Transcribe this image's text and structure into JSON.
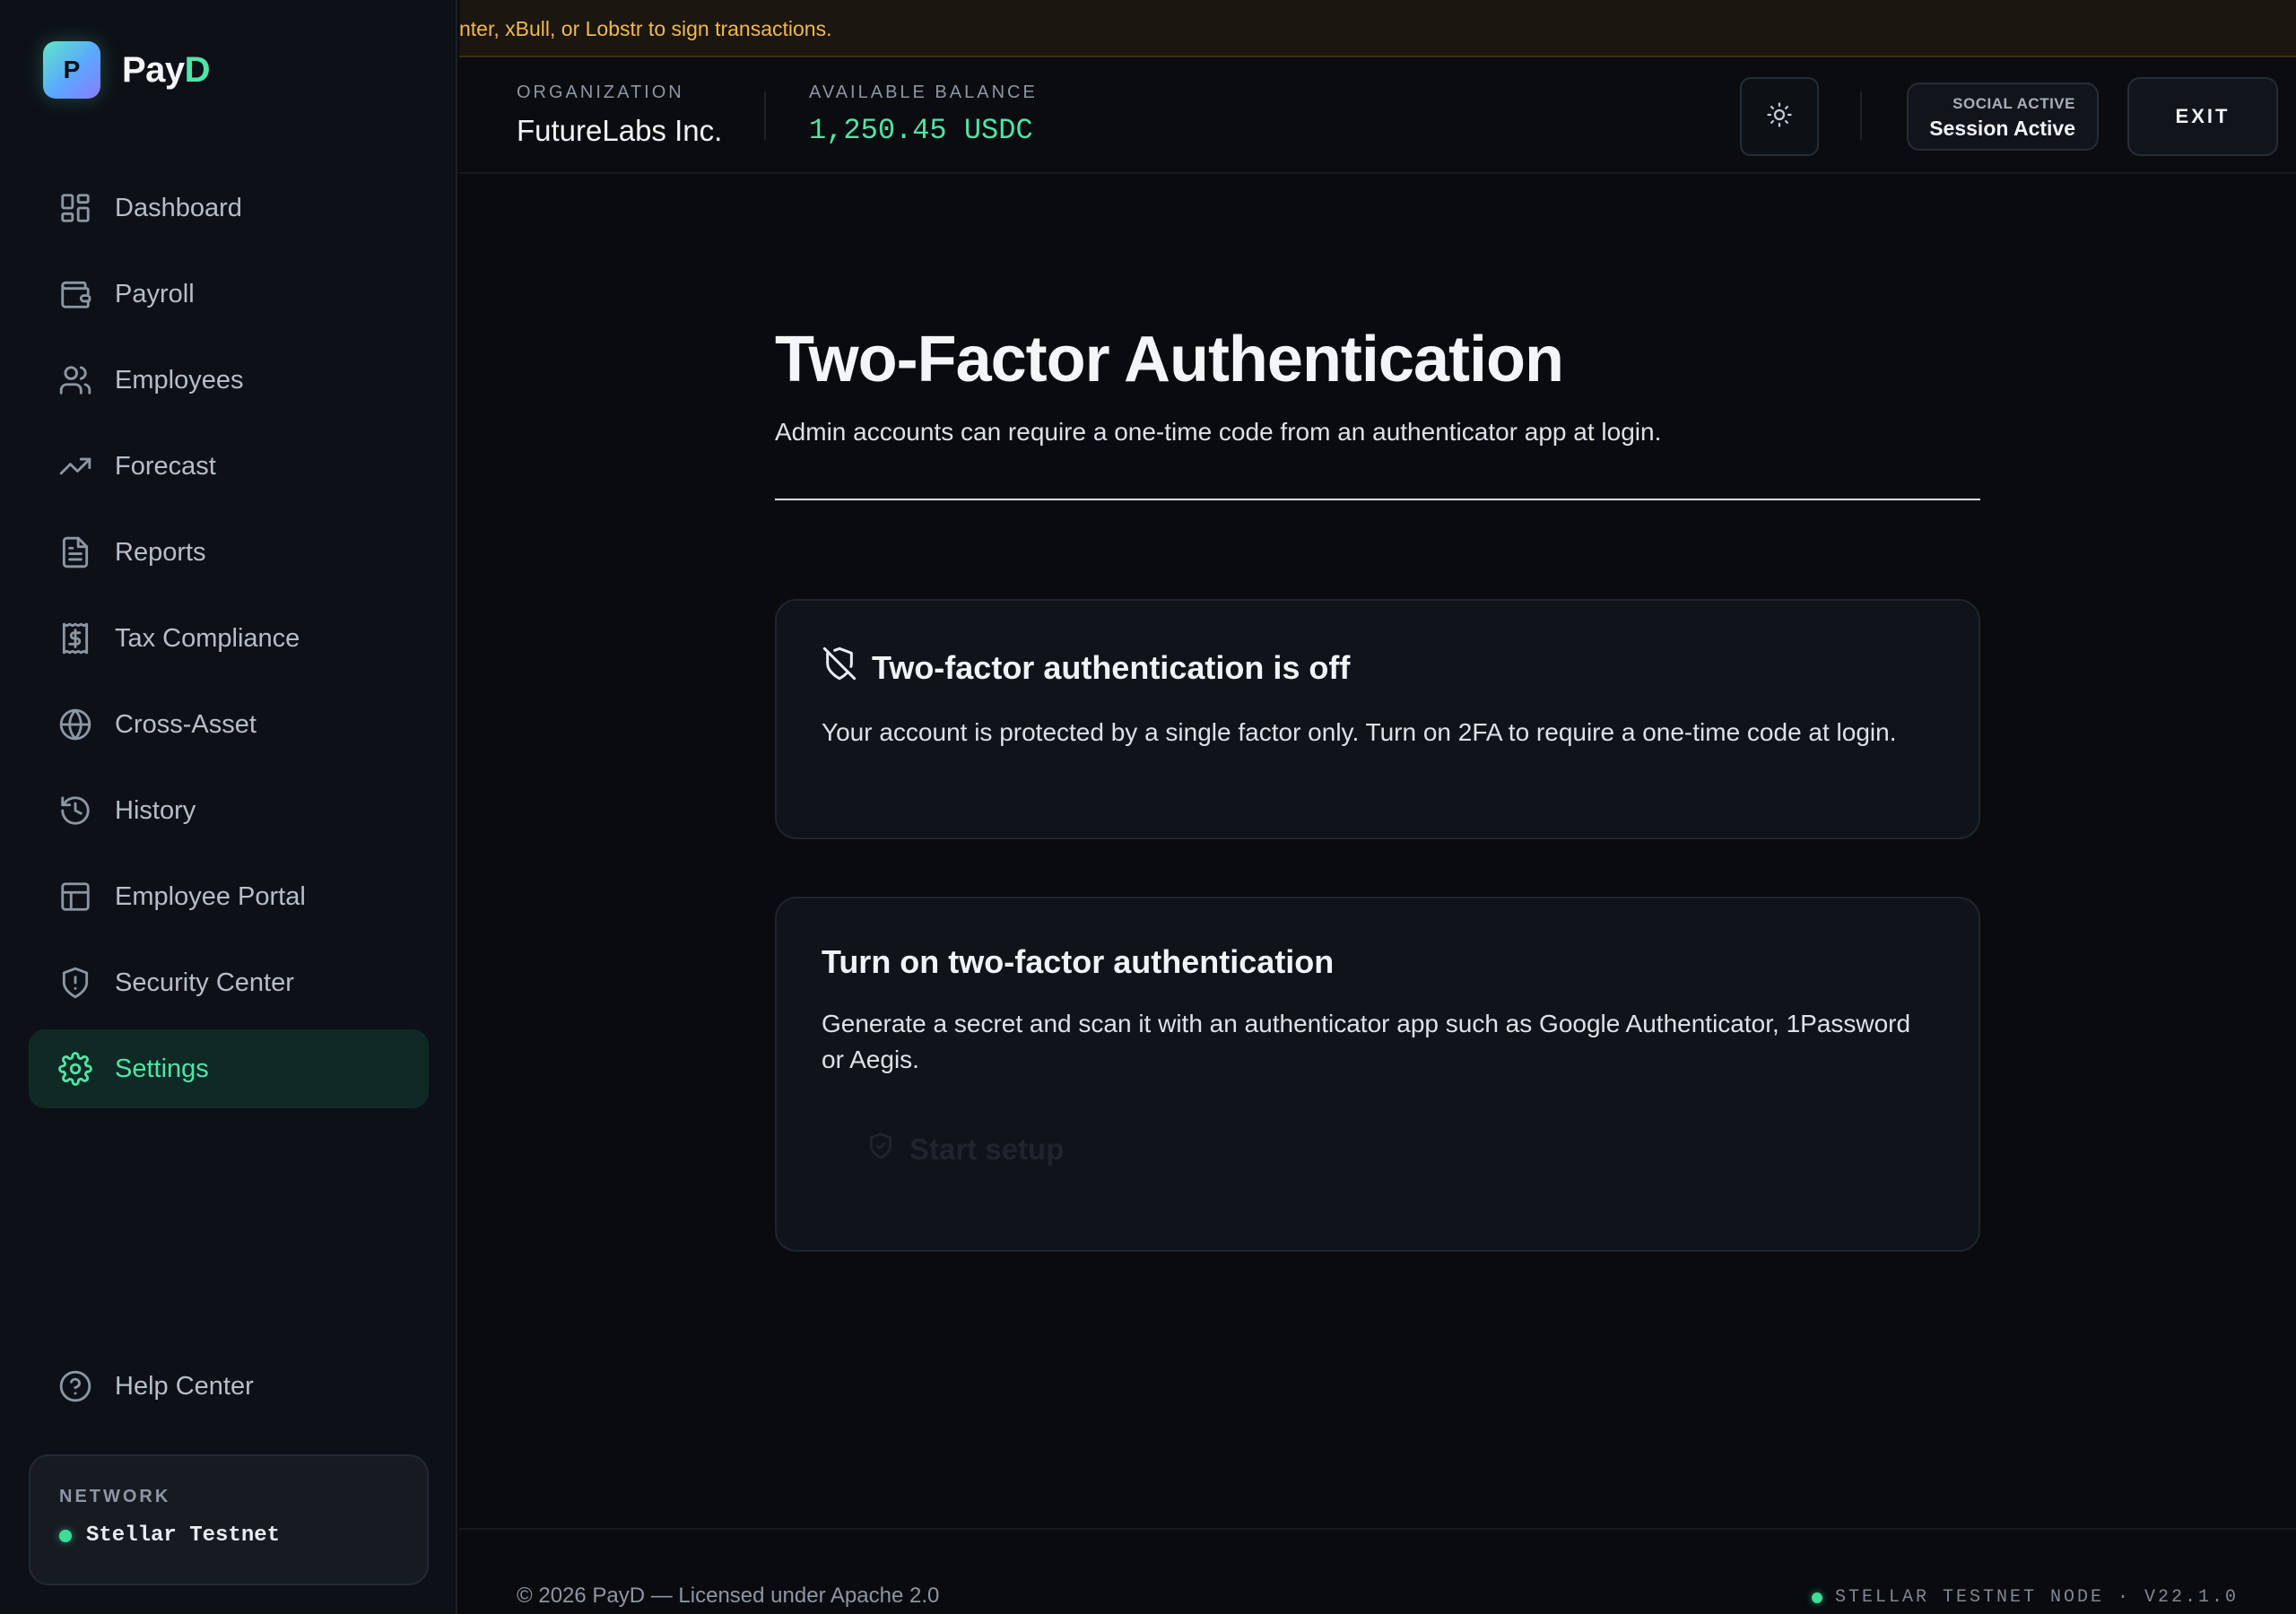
{
  "banner": {
    "text": "nter, xBull, or Lobstr to sign transactions."
  },
  "brand": {
    "mark": "P",
    "name_prefix": "Pay",
    "name_accent": "D"
  },
  "sidebar": {
    "items": [
      {
        "label": "Dashboard",
        "icon": "grid-icon"
      },
      {
        "label": "Payroll",
        "icon": "wallet-icon"
      },
      {
        "label": "Employees",
        "icon": "users-icon"
      },
      {
        "label": "Forecast",
        "icon": "trending-up-icon"
      },
      {
        "label": "Reports",
        "icon": "file-text-icon"
      },
      {
        "label": "Tax Compliance",
        "icon": "receipt-icon"
      },
      {
        "label": "Cross-Asset",
        "icon": "globe-icon"
      },
      {
        "label": "History",
        "icon": "history-icon"
      },
      {
        "label": "Employee Portal",
        "icon": "layout-icon"
      },
      {
        "label": "Security Center",
        "icon": "shield-alert-icon"
      },
      {
        "label": "Settings",
        "icon": "gear-icon",
        "active": true
      }
    ],
    "help": {
      "label": "Help Center",
      "icon": "help-circle-icon"
    },
    "network": {
      "label": "NETWORK",
      "value": "Stellar Testnet",
      "status_color": "#3ddc97"
    }
  },
  "header": {
    "organization_label": "ORGANIZATION",
    "organization_value": "FutureLabs Inc.",
    "balance_label": "AVAILABLE BALANCE",
    "balance_value": "1,250.45 USDC",
    "theme_icon": "sun-icon",
    "session_small": "SOCIAL ACTIVE",
    "session_main": "Session Active",
    "exit_label": "EXIT"
  },
  "main": {
    "title": "Two-Factor Authentication",
    "subtitle": "Admin accounts can require a one-time code from an authenticator app at login.",
    "status_card": {
      "icon": "shield-off-icon",
      "title": "Two-factor authentication is off",
      "body": "Your account is protected by a single factor only. Turn on 2FA to require a one-time code at login."
    },
    "setup_card": {
      "title": "Turn on two-factor authentication",
      "body": "Generate a secret and scan it with an authenticator app such as Google Authenticator, 1Password or Aegis.",
      "button_label": "Start setup",
      "button_icon": "shield-check-icon"
    }
  },
  "footer": {
    "left": "© 2026 PayD — Licensed under Apache 2.0",
    "right": "STELLAR TESTNET NODE · V22.1.0"
  },
  "colors": {
    "accent": "#4ee6a6",
    "warning": "#f2b94a",
    "background": "#090b0f"
  }
}
